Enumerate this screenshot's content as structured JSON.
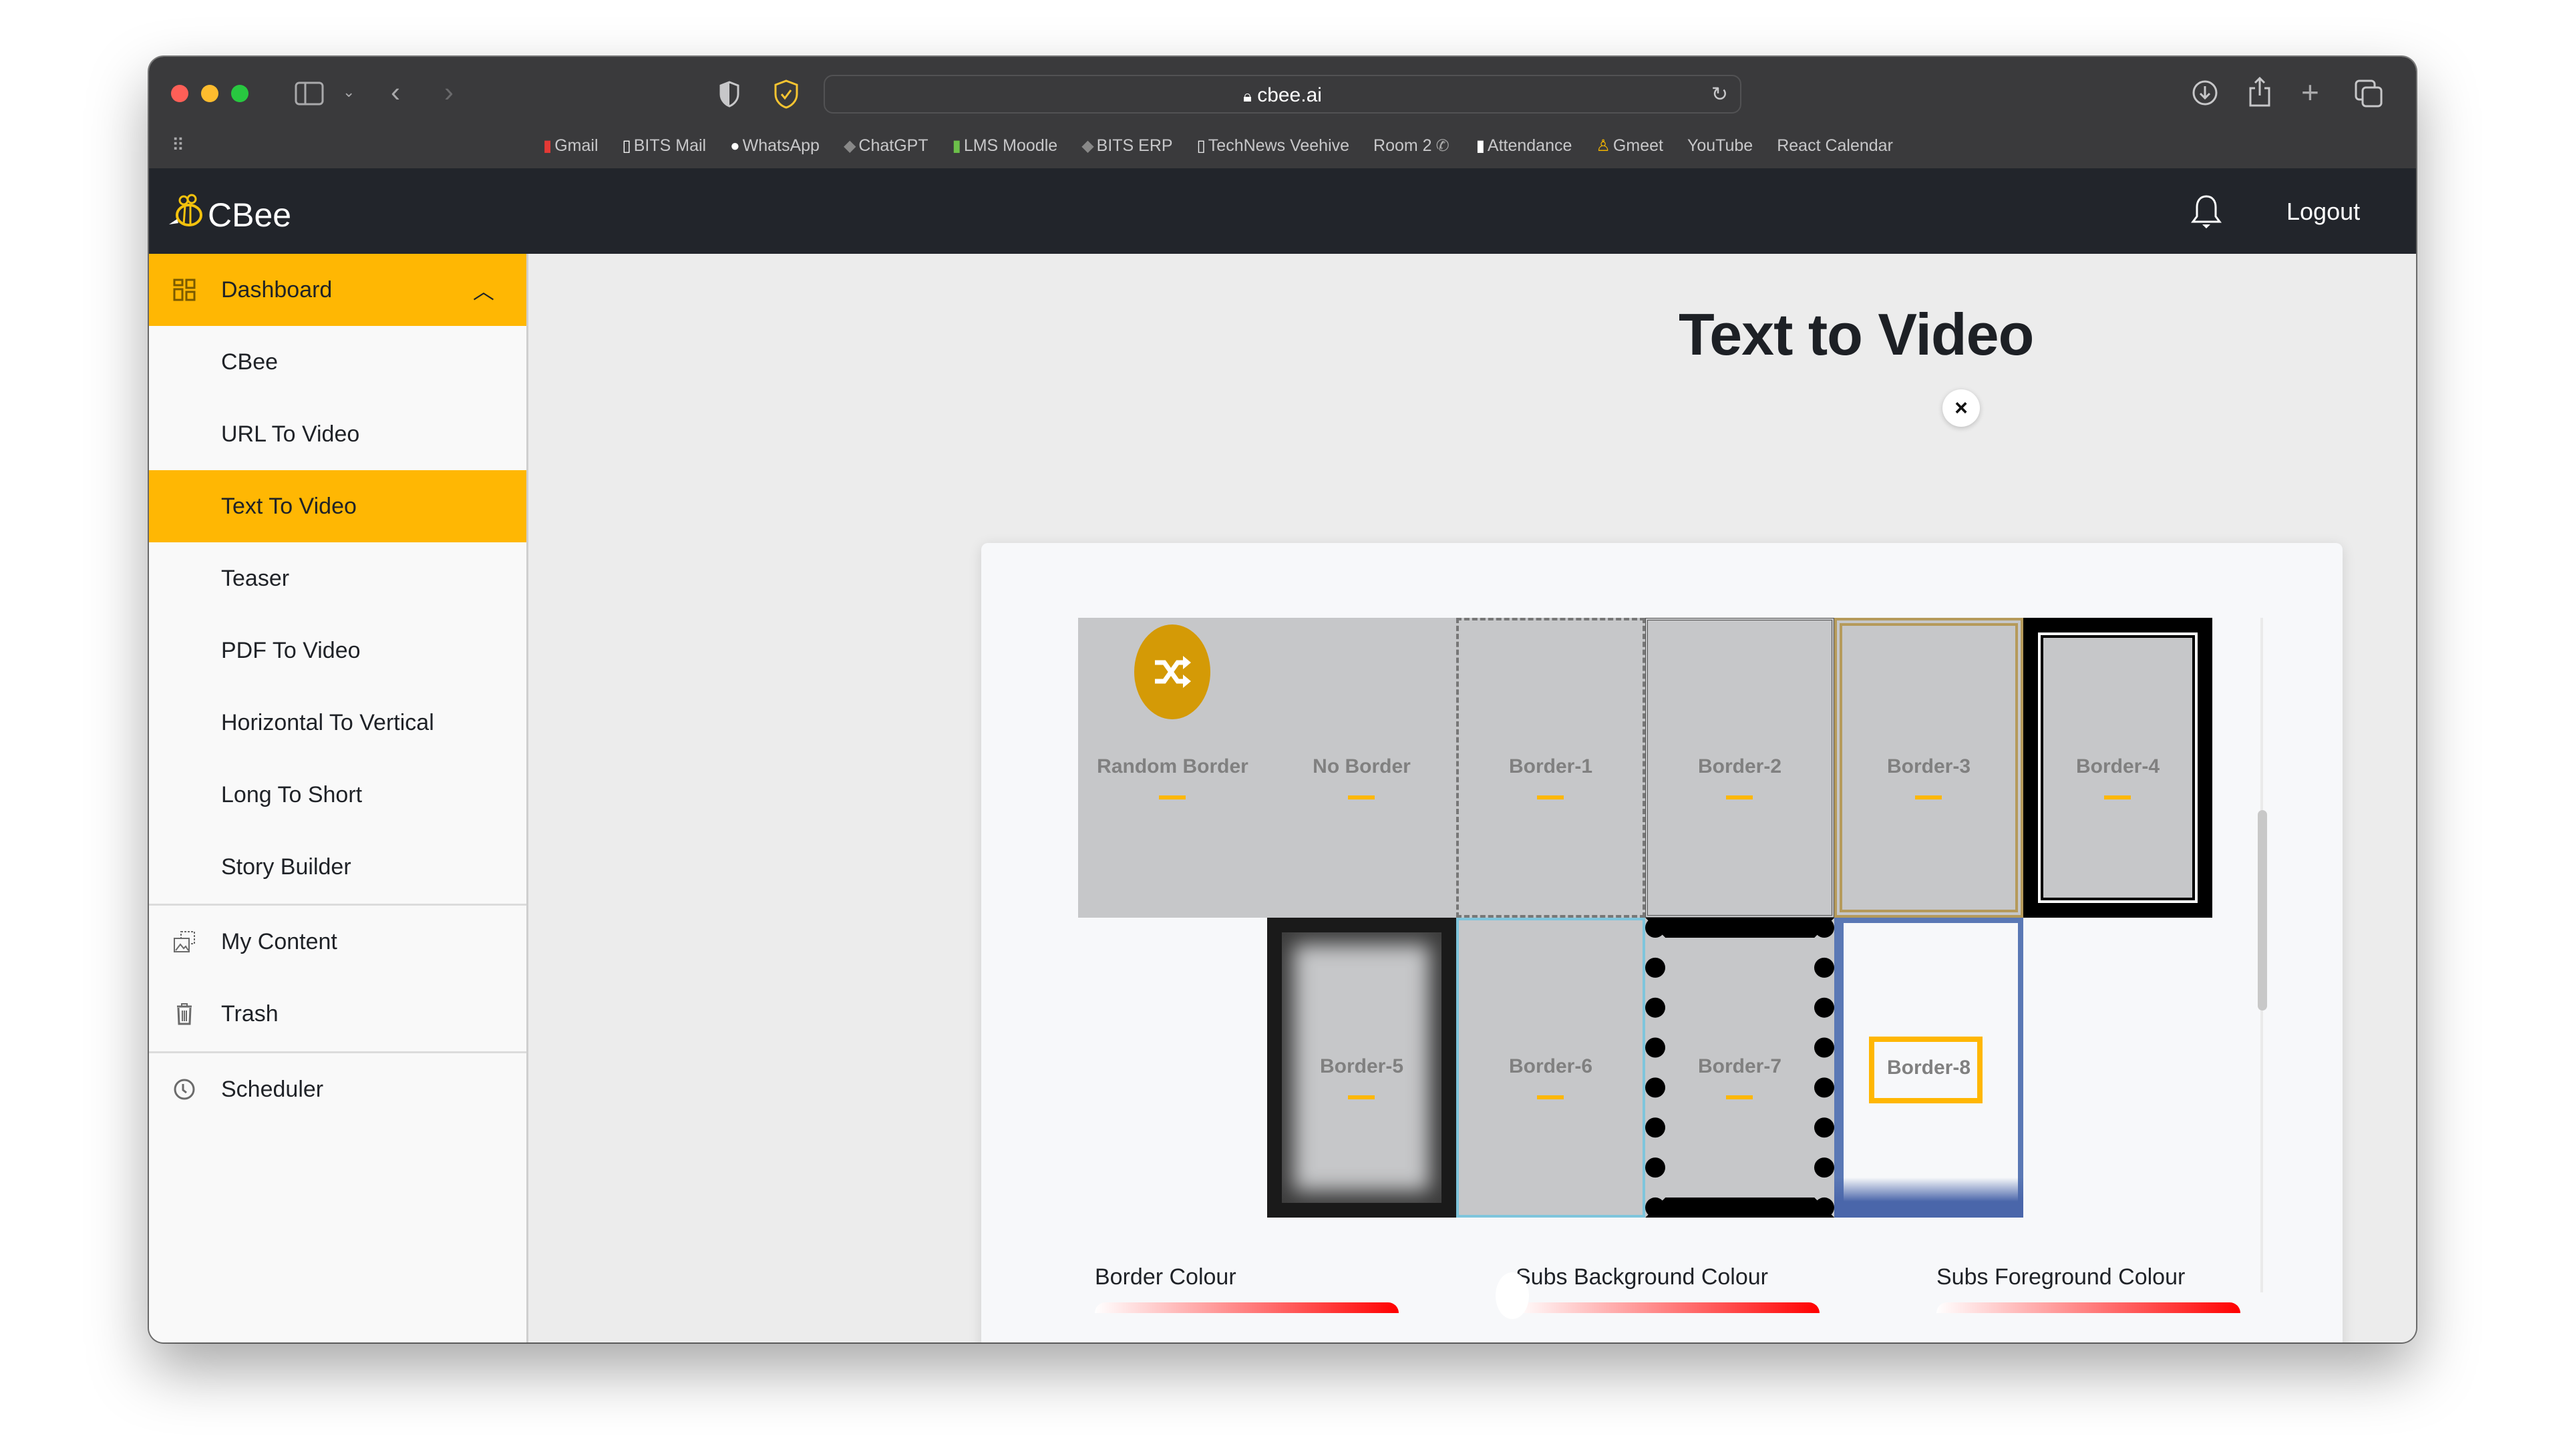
{
  "browser": {
    "url": "cbee.ai",
    "bookmarks": [
      {
        "label": "Gmail",
        "icon": "mailbox-icon"
      },
      {
        "label": "BITS Mail",
        "icon": "memo-icon"
      },
      {
        "label": "WhatsApp",
        "icon": "speech-bubble-icon"
      },
      {
        "label": "ChatGPT",
        "icon": "graduation-cap-icon"
      },
      {
        "label": "LMS Moodle",
        "icon": "books-icon"
      },
      {
        "label": "BITS ERP",
        "icon": "graduation-cap-icon"
      },
      {
        "label": "TechNews Veehive",
        "icon": "document-icon"
      },
      {
        "label": "Room 2",
        "icon": "telephone-icon"
      },
      {
        "label": "Attendance",
        "icon": "document-icon"
      },
      {
        "label": "Gmeet",
        "icon": "person-icon"
      },
      {
        "label": "YouTube",
        "icon": ""
      },
      {
        "label": "React Calendar",
        "icon": ""
      }
    ]
  },
  "header": {
    "logo": "CBee",
    "logout": "Logout"
  },
  "sidebar": {
    "dashboard": "Dashboard",
    "sub_items": [
      "CBee",
      "URL To Video",
      "Text To Video",
      "Teaser",
      "PDF To Video",
      "Horizontal To Vertical",
      "Long To Short",
      "Story Builder"
    ],
    "active_item": "Text To Video",
    "my_content": "My Content",
    "trash": "Trash",
    "scheduler": "Scheduler"
  },
  "main": {
    "title": "Text to Video"
  },
  "modal": {
    "close_label": "×",
    "borders": [
      "Random Border",
      "No Border",
      "Border-1",
      "Border-2",
      "Border-3",
      "Border-4",
      "Border-5",
      "Border-6",
      "Border-7",
      "Border-8"
    ],
    "selected_border": "Border-8",
    "color_fields": [
      "Border Colour",
      "Subs Background Colour",
      "Subs Foreground Colour"
    ],
    "accent_color": "#ffb703"
  }
}
